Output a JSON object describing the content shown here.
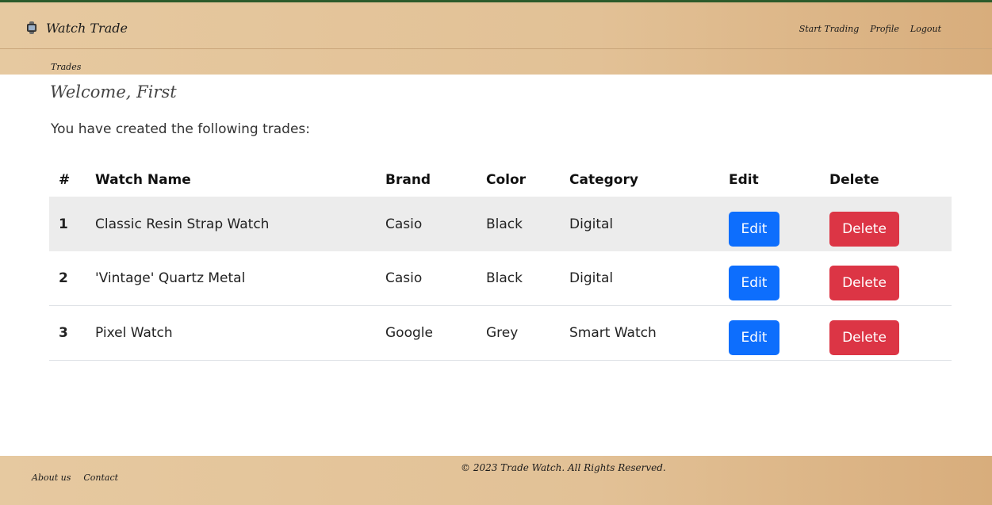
{
  "navbar": {
    "brand": "Watch Trade",
    "links": [
      "Start Trading",
      "Profile",
      "Logout"
    ],
    "subnav": "Trades"
  },
  "main": {
    "welcome": "Welcome, First",
    "intro": "You have created the following trades:",
    "table": {
      "headers": [
        "#",
        "Watch Name",
        "Brand",
        "Color",
        "Category",
        "Edit",
        "Delete"
      ],
      "rows": [
        {
          "num": "1",
          "name": "Classic Resin Strap Watch",
          "brand": "Casio",
          "color": "Black",
          "category": "Digital",
          "edit": "Edit",
          "delete": "Delete"
        },
        {
          "num": "2",
          "name": "'Vintage' Quartz Metal",
          "brand": "Casio",
          "color": "Black",
          "category": "Digital",
          "edit": "Edit",
          "delete": "Delete"
        },
        {
          "num": "3",
          "name": "Pixel Watch",
          "brand": "Google",
          "color": "Grey",
          "category": "Smart Watch",
          "edit": "Edit",
          "delete": "Delete"
        }
      ]
    }
  },
  "footer": {
    "links": [
      "About us",
      "Contact"
    ],
    "copyright": "© 2023 Trade Watch. All Rights Reserved."
  },
  "colors": {
    "edit_button": "#0d6efd",
    "delete_button": "#dc3545",
    "navbar_bg": "#e2c196",
    "striped_row": "#ececec"
  },
  "icons": {
    "brand": "watch-icon"
  }
}
